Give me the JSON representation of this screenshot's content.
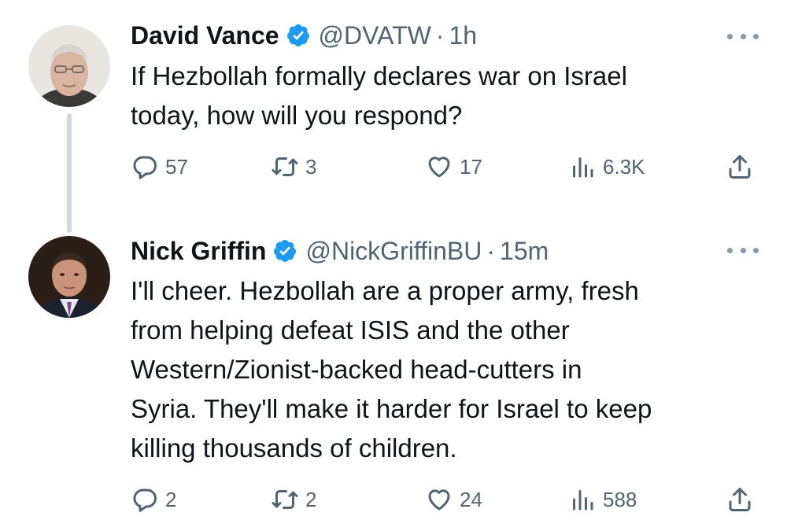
{
  "tweets": [
    {
      "name": "David Vance",
      "handle": "@DVATW",
      "separator": "·",
      "time": "1h",
      "text": "If Hezbollah formally declares war on Israel\ntoday, how will you respond?",
      "replies": "57",
      "retweets": "3",
      "likes": "17",
      "views": "6.3K"
    },
    {
      "name": "Nick Griffin",
      "handle": "@NickGriffinBU",
      "separator": "·",
      "time": "15m",
      "text": "I'll cheer. Hezbollah are a proper army, fresh\nfrom helping defeat ISIS and the other\nWestern/Zionist-backed head-cutters in\nSyria. They'll make it harder for Israel to keep\nkilling thousands of children.",
      "replies": "2",
      "retweets": "2",
      "likes": "24",
      "views": "588"
    }
  ],
  "colors": {
    "verified_blue": "#1d9bf0",
    "text": "#0f1419",
    "secondary": "#536471",
    "thread_line": "#cfd9de"
  },
  "icons": [
    "verified-badge-icon",
    "more-icon",
    "reply-icon",
    "retweet-icon",
    "like-icon",
    "views-icon",
    "share-icon"
  ]
}
